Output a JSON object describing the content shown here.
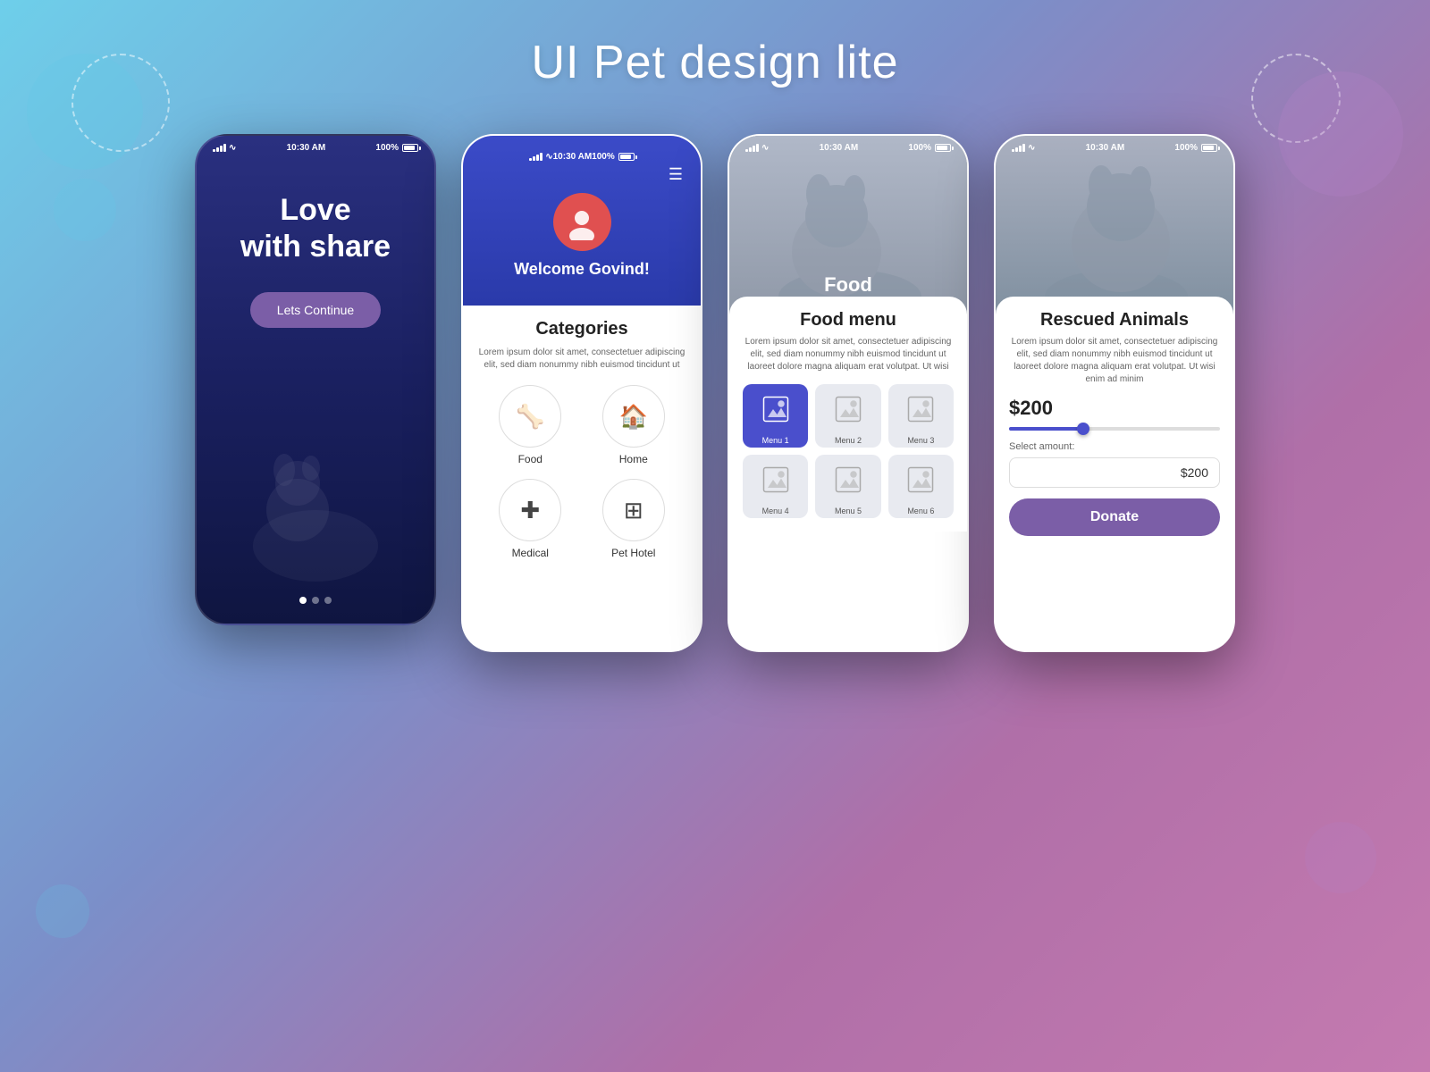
{
  "page": {
    "title": "UI Pet design lite",
    "background": "linear-gradient(135deg, #6ecfea 0%, #7b8fc9 40%, #b06fa8 70%, #c47ab0 100%)"
  },
  "phone1": {
    "status": {
      "time": "10:30 AM",
      "battery": "100%"
    },
    "heading_line1": "Love",
    "heading_line2": "with share",
    "cta_button": "Lets Continue",
    "dots": [
      "active",
      "inactive",
      "inactive"
    ]
  },
  "phone2": {
    "status": {
      "time": "10:30 AM",
      "battery": "100%"
    },
    "welcome_text": "Welcome Govind!",
    "section_title": "Categories",
    "description": "Lorem ipsum dolor sit amet, consectetuer adipiscing elit, sed diam nonummy nibh euismod tincidunt ut",
    "categories": [
      {
        "label": "Food",
        "icon": "🦴"
      },
      {
        "label": "Home",
        "icon": "🏠"
      },
      {
        "label": "Medical",
        "icon": "➕"
      },
      {
        "label": "Pet Hotel",
        "icon": "⊞"
      }
    ]
  },
  "phone3": {
    "status": {
      "time": "10:30 AM",
      "battery": "100%"
    },
    "header_title": "Food",
    "section_title": "Food menu",
    "description": "Lorem ipsum dolor sit amet, consectetuer adipiscing elit, sed diam nonummy nibh euismod tincidunt ut laoreet dolore magna aliquam erat volutpat. Ut wisi",
    "menu_items": [
      {
        "label": "Menu 1",
        "active": true
      },
      {
        "label": "Menu 2",
        "active": false
      },
      {
        "label": "Menu 3",
        "active": false
      },
      {
        "label": "Menu 4",
        "active": false
      },
      {
        "label": "Menu 5",
        "active": false
      },
      {
        "label": "Menu 6",
        "active": false
      }
    ]
  },
  "phone4": {
    "status": {
      "time": "10:30 AM",
      "battery": "100%"
    },
    "section_title": "Rescued Animals",
    "description": "Lorem ipsum dolor sit amet, consectetuer adipiscing elit, sed diam nonummy nibh euismod tincidunt ut laoreet dolore magna aliquam erat volutpat. Ut wisi enim ad minim",
    "amount_display": "$200",
    "slider_percent": 35,
    "select_amount_label": "Select amount:",
    "amount_input_value": "$200",
    "donate_button": "Donate"
  }
}
